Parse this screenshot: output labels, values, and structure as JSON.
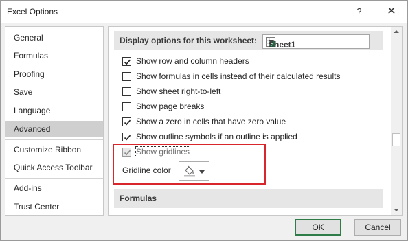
{
  "window": {
    "title": "Excel Options",
    "help_glyph": "?",
    "close_glyph": "✕"
  },
  "sidebar": {
    "items": [
      {
        "label": "General"
      },
      {
        "label": "Formulas"
      },
      {
        "label": "Proofing"
      },
      {
        "label": "Save"
      },
      {
        "label": "Language"
      },
      {
        "label": "Advanced",
        "selected": true
      },
      {
        "label": "Customize Ribbon"
      },
      {
        "label": "Quick Access Toolbar"
      },
      {
        "label": "Add-ins"
      },
      {
        "label": "Trust Center"
      }
    ]
  },
  "worksheet_section": {
    "header": "Display options for this worksheet:",
    "sheet_select": {
      "value": "Sheet1",
      "icon": "excel-sheet-icon"
    },
    "options": [
      {
        "label": "Show row and column headers",
        "checked": true
      },
      {
        "label": "Show formulas in cells instead of their calculated results",
        "checked": false
      },
      {
        "label": "Show sheet right-to-left",
        "checked": false
      },
      {
        "label": "Show page breaks",
        "checked": false
      },
      {
        "label": "Show a zero in cells that have zero value",
        "checked": true
      },
      {
        "label": "Show outline symbols if an outline is applied",
        "checked": true
      },
      {
        "label": "Show gridlines",
        "checked": true,
        "disabled": true
      }
    ],
    "gridline_color": {
      "label": "Gridline color",
      "icon": "paint-bucket-icon"
    }
  },
  "formulas_section": {
    "header": "Formulas"
  },
  "buttons": {
    "ok": "OK",
    "cancel": "Cancel"
  },
  "colors": {
    "highlight": "#d7262c",
    "selected_item": "#cfcfcf",
    "default_button_border": "#2e7d49"
  }
}
